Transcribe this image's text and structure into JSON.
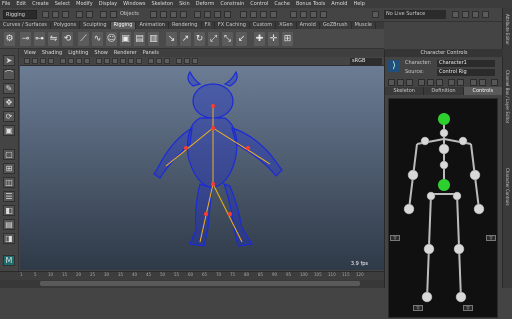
{
  "menubar": {
    "items": [
      "File",
      "Edit",
      "Create",
      "Select",
      "Modify",
      "Display",
      "Windows",
      "Skeleton",
      "Skin",
      "Deform",
      "Constrain",
      "Control",
      "Cache",
      "Bonus Tools",
      "Arnold",
      "Help"
    ]
  },
  "toolbar": {
    "mode_select": "Rigging",
    "objects_label": "Objects",
    "no_live_surface": "No Live Surface"
  },
  "shelf": {
    "tabs": [
      "Curves / Surfaces",
      "Polygons",
      "Sculpting",
      "Rigging",
      "Animation",
      "Rendering",
      "FX",
      "FX Caching",
      "Custom",
      "XGen",
      "Arnold",
      "GoZBrush",
      "Muscle"
    ],
    "active_tab": "Rigging"
  },
  "viewport": {
    "menu": [
      "View",
      "Shading",
      "Lighting",
      "Show",
      "Renderer",
      "Panels"
    ],
    "color_space": "sRGB gamma",
    "fps": "3.9 fps"
  },
  "timeline": {
    "ticks": [
      "1",
      "5",
      "10",
      "15",
      "20",
      "25",
      "30",
      "35",
      "40",
      "45",
      "50",
      "55",
      "60",
      "65",
      "70",
      "75",
      "80",
      "85",
      "90",
      "95",
      "100",
      "105",
      "110",
      "115",
      "120"
    ]
  },
  "character_controls": {
    "title": "Character Controls",
    "character_label": "Character:",
    "character_value": "Character1",
    "source_label": "Source:",
    "source_value": "Control Rig",
    "tabs": [
      "Skeleton",
      "Definition",
      "Controls"
    ],
    "active_tab": "Controls"
  },
  "right_bar": {
    "labels": [
      "Attribute Editor",
      "Channel Box / Layer Editor",
      "Character Controls"
    ]
  },
  "colors": {
    "active_tab": "#5d5d5d",
    "mesh": "#1b2bd6",
    "joint_fk": "#e8e8e8",
    "joint_active": "#2fcf2f",
    "viewport_top": "#6b7c94",
    "viewport_bottom": "#2f3a48"
  }
}
